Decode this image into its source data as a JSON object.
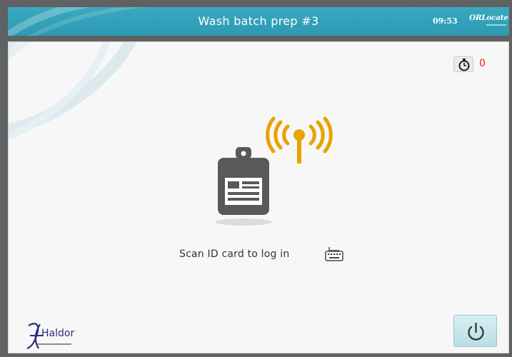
{
  "header": {
    "title": "Wash batch prep #3",
    "time": "09:53",
    "brand": "ORLocate",
    "background_color": "#35a5bc"
  },
  "main": {
    "timer_count": "0",
    "login_prompt": "Scan ID card to log in",
    "logo_text": "Haldor",
    "icons": {
      "timer": "stopwatch-icon",
      "id_card": "id-card-icon",
      "signal": "rfid-signal-icon",
      "keyboard": "keyboard-icon",
      "power": "power-icon"
    },
    "accent_color": "#e9a200"
  }
}
